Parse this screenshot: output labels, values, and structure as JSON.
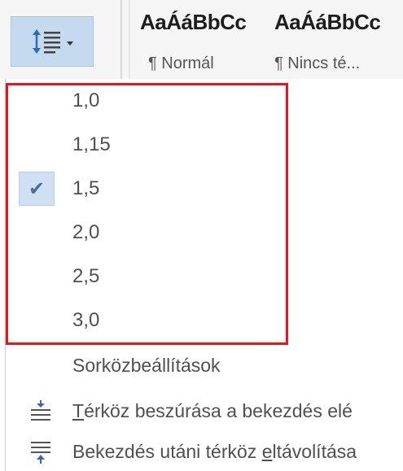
{
  "ribbon": {
    "line_spacing_button": {
      "icon": "line-paragraph-spacing-icon"
    },
    "styles": [
      {
        "sample": "AaÁáBbCc",
        "name": "¶ Normál"
      },
      {
        "sample": "AaÁáBbCc",
        "name": "¶ Nincs té..."
      }
    ]
  },
  "dropdown": {
    "spacing_options": [
      {
        "label": "1,0",
        "checked": false
      },
      {
        "label": "1,15",
        "checked": false
      },
      {
        "label": "1,5",
        "checked": true
      },
      {
        "label": "2,0",
        "checked": false
      },
      {
        "label": "2,5",
        "checked": false
      },
      {
        "label": "3,0",
        "checked": false
      }
    ],
    "check_glyph": "✔",
    "options_link": "Sorközbeállítások",
    "add_before": {
      "accel": "T",
      "rest": "érköz beszúrása a bekezdés elé",
      "icon": "add-space-before-icon"
    },
    "remove_after": {
      "pre": "Bekezdés utáni térköz ",
      "accel": "e",
      "rest": "ltávolítása",
      "icon": "remove-space-after-icon"
    },
    "highlight_color": "#e8141b"
  }
}
